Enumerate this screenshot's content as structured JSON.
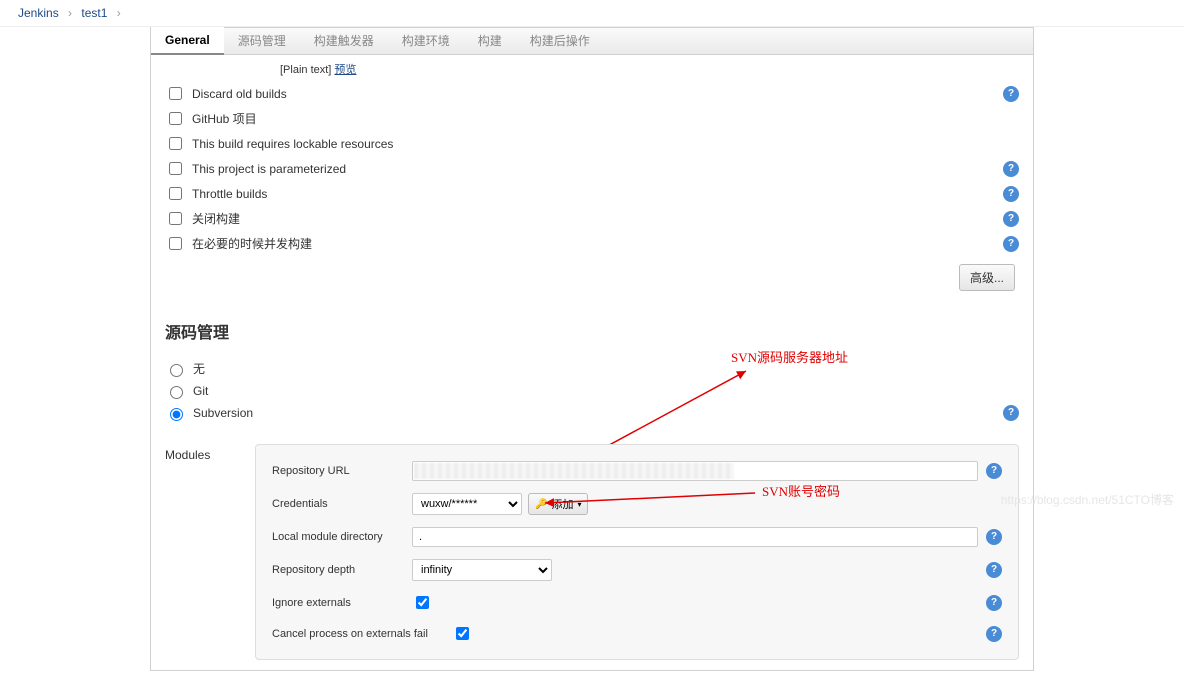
{
  "breadcrumb": {
    "root": "Jenkins",
    "item": "test1"
  },
  "tabs": [
    "General",
    "源码管理",
    "构建触发器",
    "构建环境",
    "构建",
    "构建后操作"
  ],
  "general": {
    "plain_text_label": "[Plain text]",
    "preview_label": "预览",
    "options": [
      {
        "label": "Discard old builds",
        "help": true
      },
      {
        "label": "GitHub 项目",
        "help": false
      },
      {
        "label": "This build requires lockable resources",
        "help": false
      },
      {
        "label": "This project is parameterized",
        "help": true
      },
      {
        "label": "Throttle builds",
        "help": true
      },
      {
        "label": "关闭构建",
        "help": true
      },
      {
        "label": "在必要的时候并发构建",
        "help": true
      }
    ],
    "advanced_btn": "高级..."
  },
  "scm": {
    "heading": "源码管理",
    "radios": {
      "none": "无",
      "git": "Git",
      "svn": "Subversion"
    },
    "selected": "svn",
    "svn_help": true,
    "modules_label": "Modules",
    "fields": {
      "repo_url_label": "Repository URL",
      "repo_url_value": "",
      "cred_label": "Credentials",
      "cred_selected": "wuxw/******",
      "add_btn": "添加",
      "local_dir_label": "Local module directory",
      "local_dir_value": ".",
      "depth_label": "Repository depth",
      "depth_selected": "infinity",
      "ignore_ext_label": "Ignore externals",
      "ignore_ext_checked": true,
      "cancel_ext_label": "Cancel process on externals fail",
      "cancel_ext_checked": true
    }
  },
  "annotations": {
    "svn_url": "SVN源码服务器地址",
    "svn_cred": "SVN账号密码"
  },
  "watermark": "https://blog.csdn.net/51CTO博客"
}
